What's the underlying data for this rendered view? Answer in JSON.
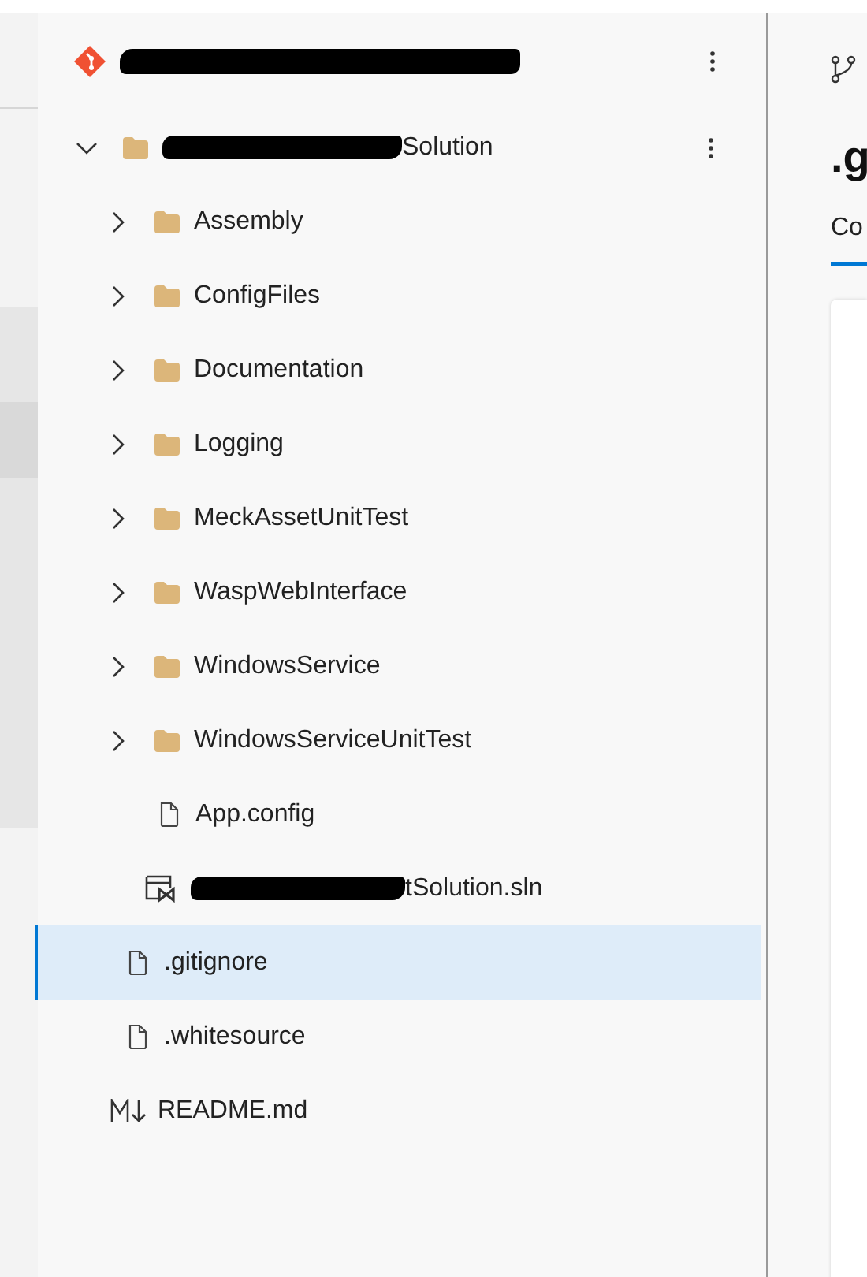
{
  "repository": {
    "title_redacted": true
  },
  "tree": [
    {
      "kind": "folder",
      "label": "Solution",
      "redacted": true,
      "expanded": true,
      "selected": false,
      "children": [
        {
          "kind": "folder",
          "label": "Assembly",
          "redacted": false,
          "expanded": false,
          "selected": false
        },
        {
          "kind": "folder",
          "label": "ConfigFiles",
          "redacted": false,
          "expanded": false,
          "selected": false
        },
        {
          "kind": "folder",
          "label": "Documentation",
          "redacted": false,
          "expanded": false,
          "selected": false
        },
        {
          "kind": "folder",
          "label": "Logging",
          "redacted": false,
          "expanded": false,
          "selected": false
        },
        {
          "kind": "folder",
          "label": "MeckAssetUnitTest",
          "redacted": false,
          "expanded": false,
          "selected": false
        },
        {
          "kind": "folder",
          "label": "WaspWebInterface",
          "redacted": false,
          "expanded": false,
          "selected": false
        },
        {
          "kind": "folder",
          "label": "WindowsService",
          "redacted": false,
          "expanded": false,
          "selected": false
        },
        {
          "kind": "folder",
          "label": "WindowsServiceUnitTest",
          "redacted": false,
          "expanded": false,
          "selected": false
        },
        {
          "kind": "file",
          "label": "App.config",
          "redacted": false,
          "selected": false
        },
        {
          "kind": "solution",
          "label": "tSolution.sln",
          "redacted": true,
          "selected": false
        }
      ]
    },
    {
      "kind": "file",
      "label": ".gitignore",
      "redacted": false,
      "selected": true
    },
    {
      "kind": "file",
      "label": ".whitesource",
      "redacted": false,
      "selected": false
    },
    {
      "kind": "markdown",
      "label": "README.md",
      "redacted": false,
      "selected": false
    }
  ],
  "detail": {
    "title": ".g",
    "tabs": [
      {
        "label": "Co",
        "selected": true
      }
    ]
  }
}
